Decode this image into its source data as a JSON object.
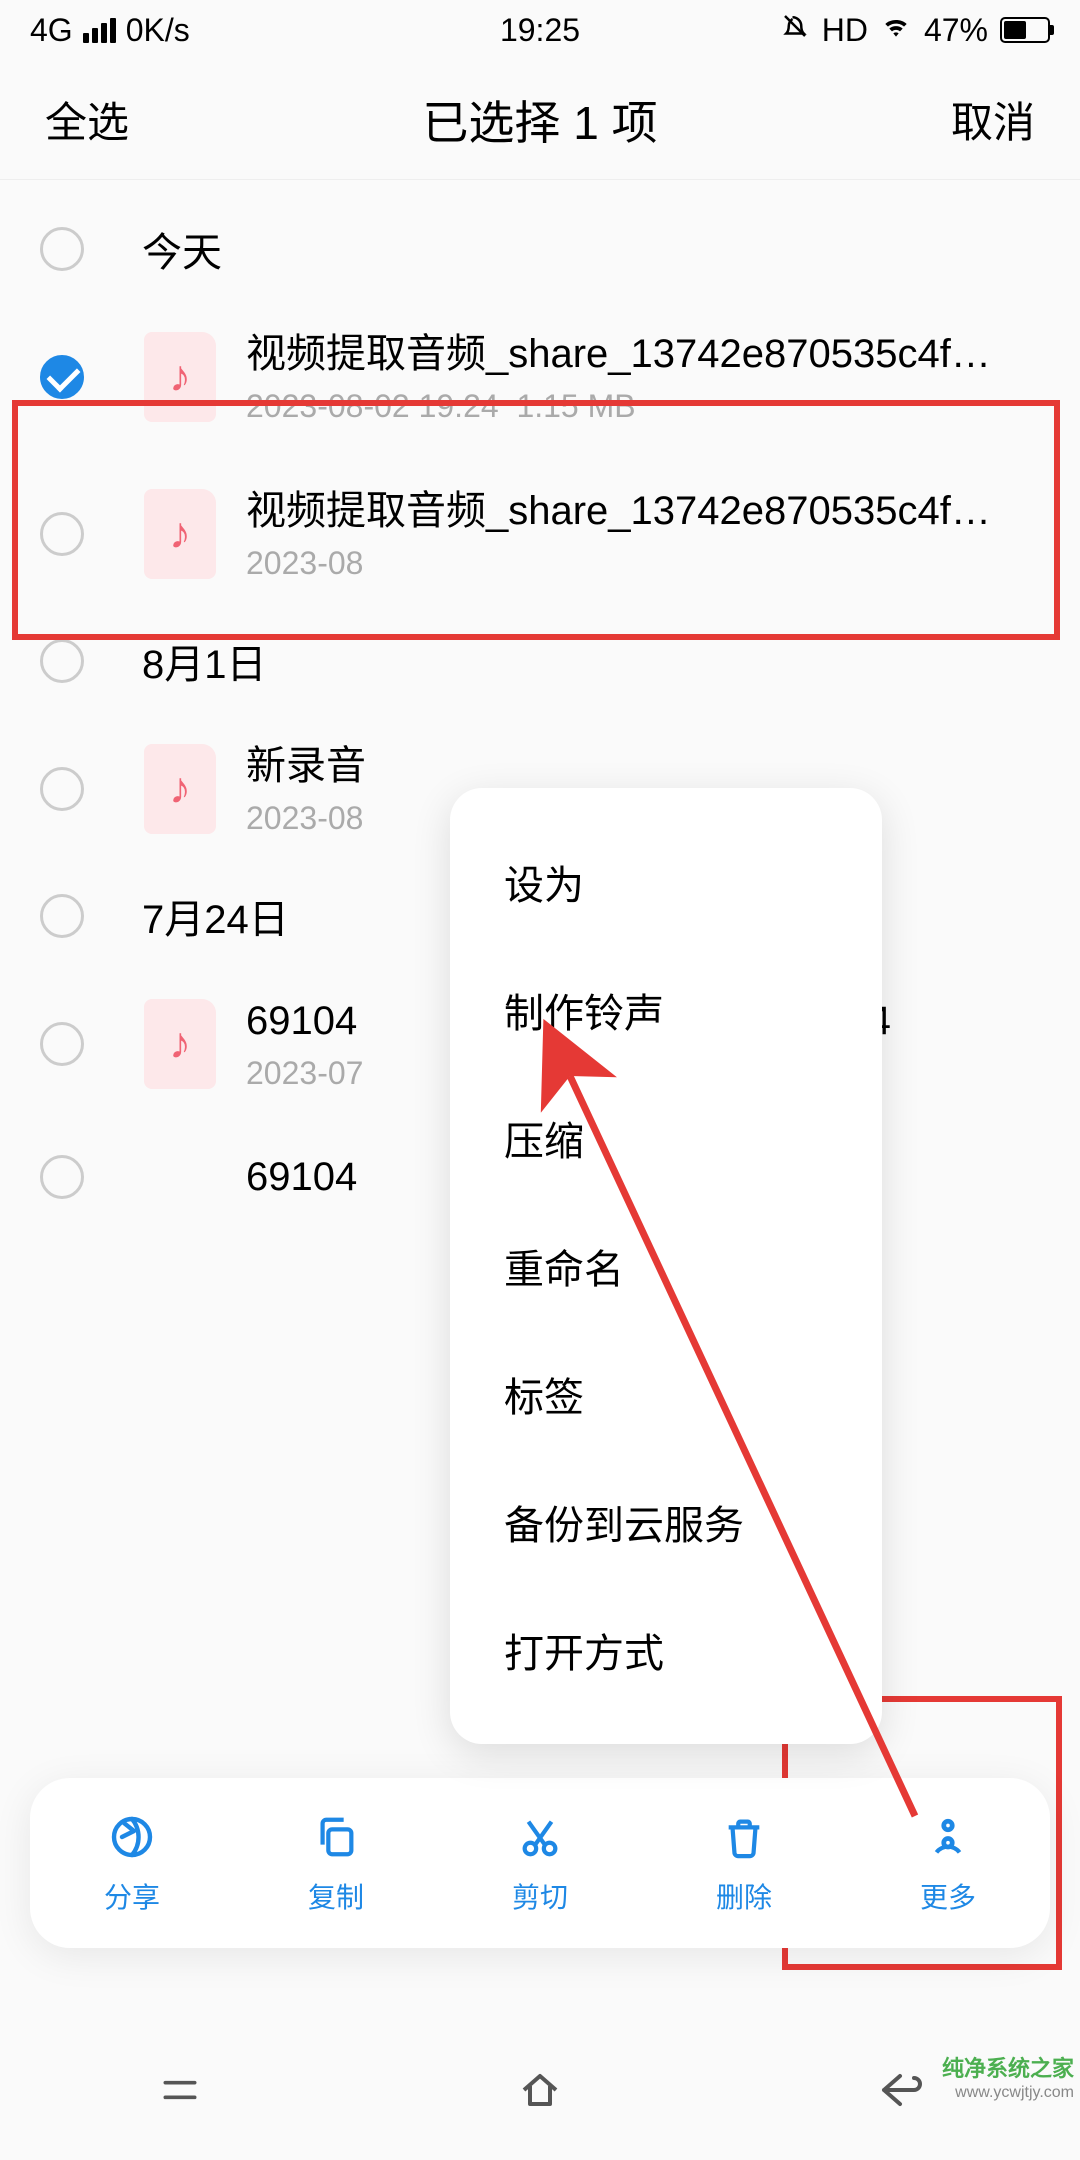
{
  "status": {
    "network": "4G",
    "speed": "0K/s",
    "time": "19:25",
    "hd": "HD",
    "battery": "47%"
  },
  "header": {
    "select_all": "全选",
    "title": "已选择 1 项",
    "cancel": "取消"
  },
  "sections": [
    {
      "title": "今天",
      "items": [
        {
          "name": "视频提取音频_share_13742e870535c4f…",
          "date": "2023-08-02 19:24",
          "size": "1.15 MB",
          "checked": true
        },
        {
          "name": "视频提取音频_share_13742e870535c4f…",
          "date": "2023-08",
          "size": "",
          "checked": false
        }
      ]
    },
    {
      "title": "8月1日",
      "items": [
        {
          "name": "新录音",
          "date": "2023-08",
          "size": "",
          "checked": false
        }
      ]
    },
    {
      "title": "7月24日",
      "items": [
        {
          "name": "69104                                20230724",
          "date": "2023-07",
          "size": "",
          "checked": false
        },
        {
          "name": "69104                                  np3",
          "date": "",
          "size": "",
          "checked": false
        }
      ]
    }
  ],
  "popup": {
    "items": [
      "设为",
      "制作铃声",
      "压缩",
      "重命名",
      "标签",
      "备份到云服务",
      "打开方式"
    ]
  },
  "bottom": {
    "share": "分享",
    "copy": "复制",
    "cut": "剪切",
    "delete": "删除",
    "more": "更多"
  },
  "watermark": {
    "line1": "纯净系统之家",
    "line2": "www.ycwjtjy.com"
  }
}
